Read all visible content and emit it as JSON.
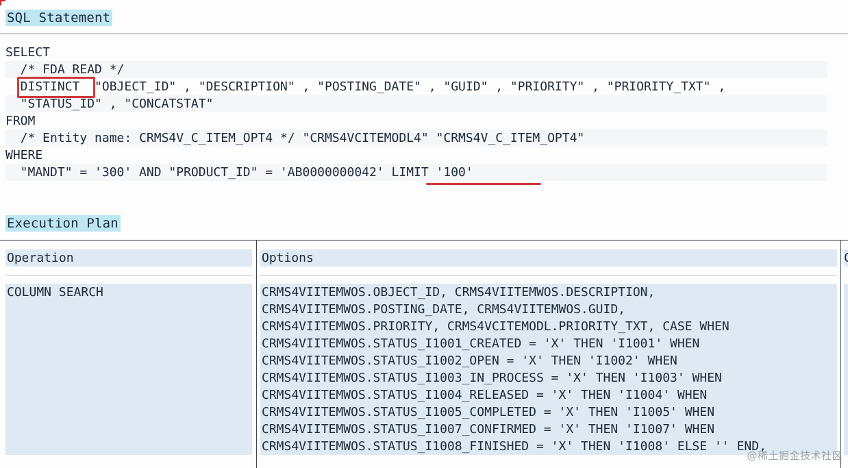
{
  "sql_statement": {
    "title": "SQL Statement",
    "lines": [
      "SELECT",
      "  /* FDA READ */",
      "  DISTINCT  \"OBJECT_ID\" , \"DESCRIPTION\" , \"POSTING_DATE\" , \"GUID\" , \"PRIORITY\" , \"PRIORITY_TXT\" ,",
      "  \"STATUS_ID\" , \"CONCATSTAT\"",
      "FROM",
      "  /* Entity name: CRMS4V_C_ITEM_OPT4 */ \"CRMS4VCITEMODL4\" \"CRMS4V_C_ITEM_OPT4\"",
      "WHERE",
      "  \"MANDT\" = '300' AND \"PRODUCT_ID\" = 'AB0000000042' LIMIT '100'"
    ],
    "highlight_word": "DISTINCT",
    "underline_text": "LIMIT '100'"
  },
  "execution_plan": {
    "title": "Execution Plan",
    "columns": [
      "Operation",
      "Options",
      "C"
    ],
    "rows": [
      {
        "operation": "COLUMN SEARCH",
        "options": [
          "CRMS4VIITEMWOS.OBJECT_ID, CRMS4VIITEMWOS.DESCRIPTION,",
          "CRMS4VIITEMWOS.POSTING_DATE, CRMS4VIITEMWOS.GUID,",
          "CRMS4VIITEMWOS.PRIORITY, CRMS4VCITEMODL.PRIORITY_TXT, CASE WHEN",
          "CRMS4VIITEMWOS.STATUS_I1001_CREATED = 'X' THEN 'I1001' WHEN",
          "CRMS4VIITEMWOS.STATUS_I1002_OPEN = 'X' THEN 'I1002' WHEN",
          "CRMS4VIITEMWOS.STATUS_I1003_IN_PROCESS = 'X' THEN 'I1003' WHEN",
          "CRMS4VIITEMWOS.STATUS_I1004_RELEASED = 'X' THEN 'I1004' WHEN",
          "CRMS4VIITEMWOS.STATUS_I1005_COMPLETED = 'X' THEN 'I1005' WHEN",
          "CRMS4VIITEMWOS.STATUS_I1007_CONFIRMED = 'X' THEN 'I1007' WHEN",
          "CRMS4VIITEMWOS.STATUS_I1008_FINISHED = 'X' THEN 'I1008' ELSE '' END,"
        ]
      }
    ]
  },
  "watermark": "@稀土掘金技术社区",
  "colors": {
    "title_bg": "#bfe7f3",
    "cell_bg": "#dfe9f3",
    "annotation_red": "#d03a3a"
  }
}
